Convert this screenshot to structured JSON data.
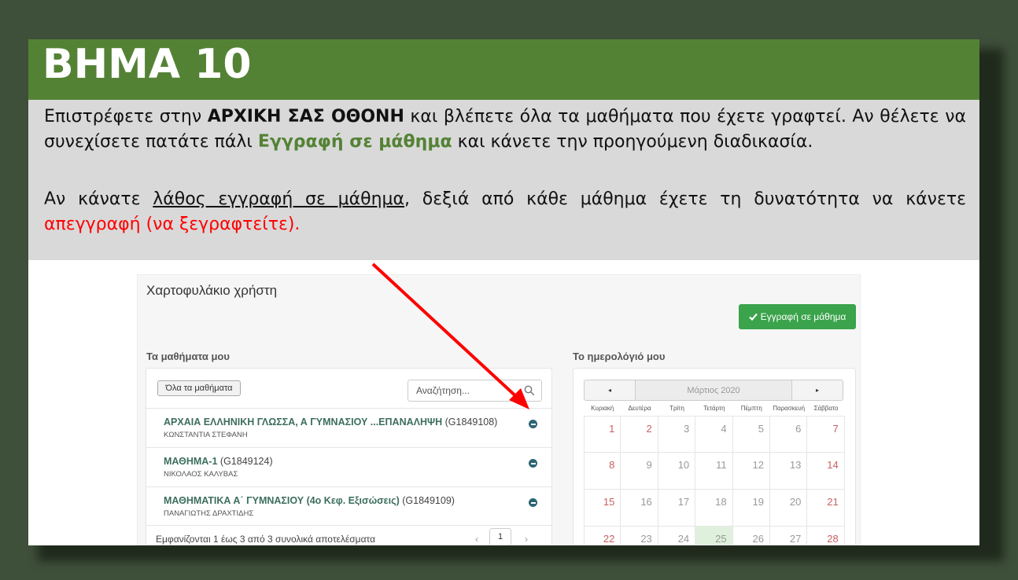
{
  "slide": {
    "title": "ΒΗΜΑ 10",
    "para1": {
      "t1": "Επιστρέφετε στην ",
      "b1": "ΑΡΧΙΚΗ ΣΑΣ ΟΘΟΝΗ",
      "t2": " και βλέπετε όλα τα μαθήματα που έχετε γραφτεί. Αν θέλετε να συνεχίσετε πατάτε πάλι ",
      "g1": "Εγγραφή σε μάθημα",
      "t3": " και κάνετε την προηγούμενη διαδικασία."
    },
    "para2": {
      "t1": "Αν κάνατε ",
      "u1": "λάθος εγγραφή σε μάθημα",
      "t2": ", δεξιά από κάθε μάθημα έχετε τη δυνατότητα να κάνετε ",
      "r1": "απεγγραφή (να ξεγραφτείτε)."
    },
    "colors": {
      "title_bar": "#548235",
      "text_box": "#d9d9d9",
      "highlight_green": "#548235",
      "highlight_red": "#ff0000"
    }
  },
  "portfolio": {
    "title": "Χαρτοφυλάκιο χρήστη",
    "enroll_button": "Εγγραφή σε μάθημα",
    "enroll_icon": "check-icon",
    "my_courses_label": "Τα μαθήματα μου",
    "filter_button": "Όλα τα μαθήματα",
    "search_placeholder": "Αναζήτηση...",
    "courses": [
      {
        "name": "ΑΡΧΑΙΑ ΕΛΛΗΝΙΚΗ ΓΛΩΣΣΑ, Α ΓΥΜΝΑΣΙΟΥ ...ΕΠΑΝΑΛΗΨΗ",
        "code": "(G1849108)",
        "teacher": "ΚΩΝΣΤΑΝΤΙΑ ΣΤΕΦΑΝΗ"
      },
      {
        "name": "ΜΑΘΗΜΑ-1",
        "code": "(G1849124)",
        "teacher": "ΝΙΚΟΛΑΟΣ ΚΑΛΥΒΑΣ"
      },
      {
        "name": "ΜΑΘΗΜΑΤΙΚΑ Α΄ ΓΥΜΝΑΣΙΟΥ (4ο Κεφ. Εξισώσεις)",
        "code": "(G1849109)",
        "teacher": "ΠΑΝΑΓΙΩΤΗΣ ΔΡΑΧΤΙΔΗΣ"
      }
    ],
    "results_text": "Εμφανίζονται 1 έως 3 από 3 συνολικά αποτελέσματα",
    "pager": {
      "prev": "‹",
      "current": "1",
      "next": "›"
    },
    "calendar_label": "Το ημερολόγιό μου",
    "calendar": {
      "prev": "◂",
      "next": "▸",
      "month": "Μάρτιος 2020",
      "weekdays": [
        "Κυριακή",
        "Δευτέρα",
        "Τρίτη",
        "Τετάρτη",
        "Πέμπτη",
        "Παρασκευή",
        "Σάββατο"
      ],
      "weeks": [
        [
          "1",
          "2",
          "3",
          "4",
          "5",
          "6",
          "7"
        ],
        [
          "8",
          "9",
          "10",
          "11",
          "12",
          "13",
          "14"
        ],
        [
          "15",
          "16",
          "17",
          "18",
          "19",
          "20",
          "21"
        ],
        [
          "22",
          "23",
          "24",
          "25",
          "26",
          "27",
          "28"
        ]
      ],
      "today": "25"
    }
  }
}
